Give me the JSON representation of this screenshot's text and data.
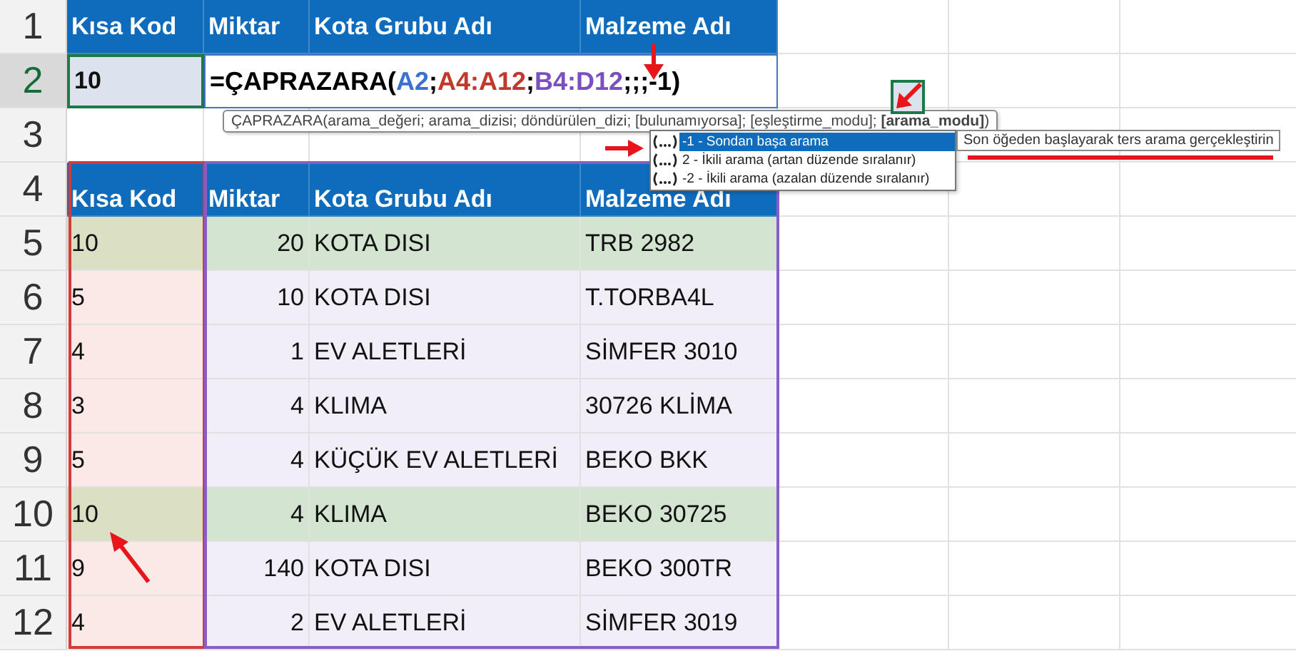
{
  "row_numbers": [
    {
      "label": "1",
      "selected": false
    },
    {
      "label": "2",
      "selected": true
    },
    {
      "label": "3",
      "selected": false
    },
    {
      "label": "4",
      "selected": false
    },
    {
      "label": "5",
      "selected": false
    },
    {
      "label": "6",
      "selected": false
    },
    {
      "label": "7",
      "selected": false
    },
    {
      "label": "8",
      "selected": false
    },
    {
      "label": "9",
      "selected": false
    },
    {
      "label": "10",
      "selected": false
    },
    {
      "label": "11",
      "selected": false
    },
    {
      "label": "12",
      "selected": false
    }
  ],
  "top_headers": [
    "Kısa Kod",
    "Miktar",
    "Kota Grubu Adı",
    "Malzeme Adı"
  ],
  "lookup_value": "10",
  "formula": [
    {
      "text": "=ÇAPRAZARA(",
      "color": "#000000"
    },
    {
      "text": "A2",
      "color": "#3a72d0"
    },
    {
      "text": ";",
      "color": "#000000"
    },
    {
      "text": "A4:A12",
      "color": "#c0392b"
    },
    {
      "text": ";",
      "color": "#000000"
    },
    {
      "text": "B4:D12",
      "color": "#7b4fc0"
    },
    {
      "text": ";;;-1)",
      "color": "#000000"
    }
  ],
  "syntax_tooltip": "ÇAPRAZARA(arama_değeri; arama_dizisi; döndürülen_dizi; [bulunamıyorsa]; [eşleştirme_modu]; **[arama_modu]**)",
  "options": [
    {
      "label": "-1 - Sondan başa arama",
      "selected": true
    },
    {
      "label": "2 - İkili arama (artan düzende sıralanır)",
      "selected": false
    },
    {
      "label": "-2 - İkili arama (azalan düzende sıralanır)",
      "selected": false
    }
  ],
  "option_description": "Son öğeden başlayarak ters arama gerçekleştirin",
  "table": {
    "columns": [
      "Kısa Kod",
      "Miktar",
      "Kota Grubu Adı",
      "Malzeme Adı"
    ],
    "rows": [
      {
        "code": "10",
        "qty": "20",
        "group": "KOTA DISI",
        "material": "TRB 2982",
        "match": true
      },
      {
        "code": "5",
        "qty": "10",
        "group": "KOTA DISI",
        "material": "T.TORBA4L",
        "match": false
      },
      {
        "code": "4",
        "qty": "1",
        "group": "EV ALETLERİ",
        "material": "SİMFER 3010",
        "match": false
      },
      {
        "code": "3",
        "qty": "4",
        "group": "KLIMA",
        "material": "30726 KLİMA",
        "match": false
      },
      {
        "code": "5",
        "qty": "4",
        "group": "KÜÇÜK EV ALETLERİ",
        "material": "BEKO BKK",
        "match": false
      },
      {
        "code": "10",
        "qty": "4",
        "group": "KLIMA",
        "material": "BEKO 30725",
        "match": true
      },
      {
        "code": "9",
        "qty": "140",
        "group": "KOTA DISI",
        "material": "BEKO 300TR",
        "match": false
      },
      {
        "code": "4",
        "qty": "2",
        "group": "EV ALETLERİ",
        "material": "SİMFER 3019",
        "match": false
      }
    ]
  }
}
